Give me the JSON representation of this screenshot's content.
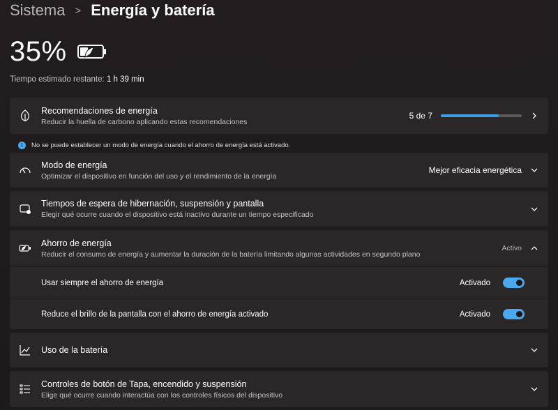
{
  "breadcrumb": {
    "parent": "Sistema",
    "separator": ">",
    "current": "Energía y batería"
  },
  "battery": {
    "percent": "35%",
    "level": 0.35,
    "charging_icon": "battery-leaf-icon"
  },
  "remaining": {
    "label": "Tiempo estimado restante:",
    "value": "1 h 39 min"
  },
  "recommendations": {
    "title": "Recomendaciones de energía",
    "subtitle": "Reducir la huella de carbono aplicando estas recomendaciones",
    "count": "5 de 7",
    "progress": 0.714
  },
  "info": {
    "text": "No se puede establecer un modo de energía cuando el ahorro de energía está activado."
  },
  "power_mode": {
    "title": "Modo de energía",
    "subtitle": "Optimizar el dispositivo en función del uso y el rendimiento de la energía",
    "value": "Mejor eficacia energética"
  },
  "timeouts": {
    "title": "Tiempos de espera de hibernación, suspensión y pantalla",
    "subtitle": "Elegir qué ocurre cuando el dispositivo está inactivo durante un tiempo especificado"
  },
  "saver": {
    "title": "Ahorro de energía",
    "subtitle": "Reducir el consumo de energía y aumentar la duración de la batería limitando algunas actividades en segundo plano",
    "status": "Activo",
    "always": {
      "label": "Usar siempre el ahorro de energía",
      "state": "Activado"
    },
    "brightness": {
      "label": "Reduce el brillo de la pantalla con el ahorro de energía activado",
      "state": "Activado"
    }
  },
  "usage": {
    "title": "Uso de la batería"
  },
  "controls": {
    "title": "Controles de botón de Tapa, encendido y suspensión",
    "subtitle": "Elige qué ocurre cuando interactúa con los controles físicos del dispositivo"
  },
  "colors": {
    "accent": "#4aa8f0",
    "card": "#2b2628",
    "background": "#1f1b1d"
  }
}
